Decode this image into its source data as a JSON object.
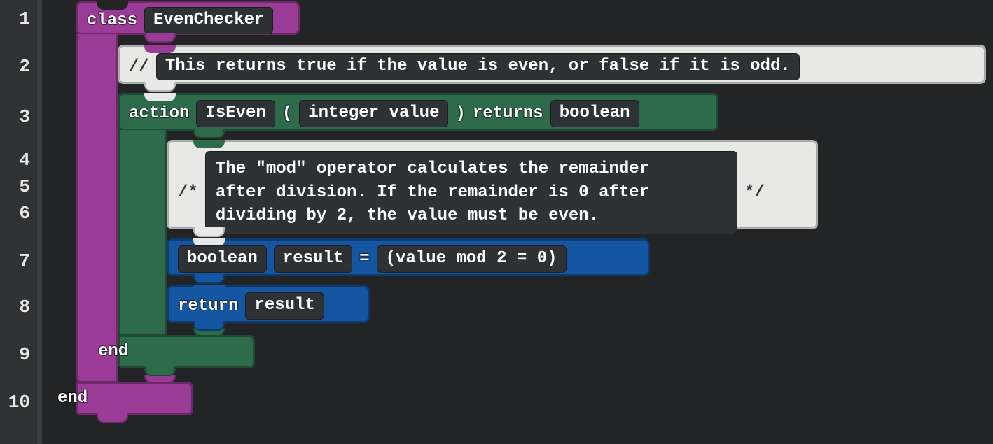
{
  "line_numbers": [
    "1",
    "2",
    "3",
    "4",
    "5",
    "6",
    "7",
    "8",
    "9",
    "10"
  ],
  "class_block": {
    "keyword": "class",
    "name": "EvenChecker",
    "end": "end"
  },
  "comment1": {
    "marker": "//",
    "text": " This returns true if the value is even, or false if it is odd."
  },
  "action_block": {
    "keyword": "action",
    "name": "IsEven",
    "lparen": "(",
    "param": "integer value",
    "rparen": ")",
    "returns": "returns",
    "return_type": "boolean",
    "end": "end"
  },
  "comment2": {
    "open": "/*",
    "text": "The \"mod\" operator calculates the remainder\nafter division. If the remainder is 0 after\ndividing by 2, the value must be even.",
    "close": "*/"
  },
  "stmt1": {
    "type": "boolean",
    "varname": "result",
    "eq": "=",
    "expr": "(value mod 2 = 0)"
  },
  "stmt2": {
    "keyword": "return",
    "expr": "result"
  }
}
